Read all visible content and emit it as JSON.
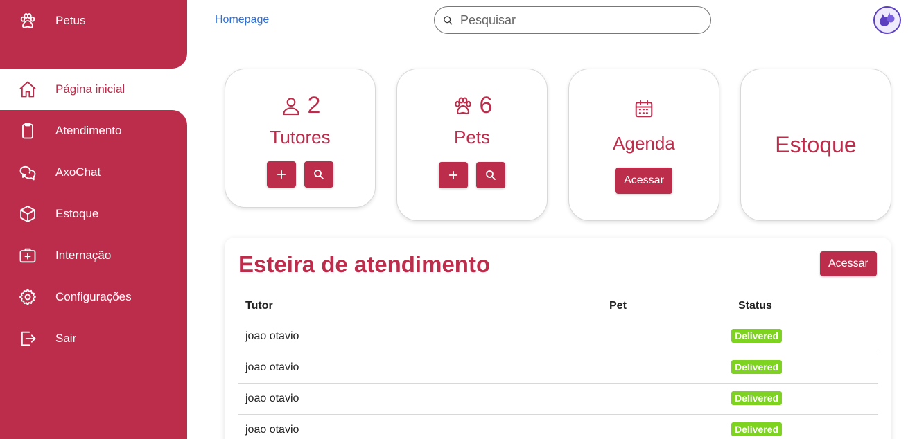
{
  "sidebar": {
    "brand": "Petus",
    "items": [
      {
        "label": "Página inicial",
        "icon": "home-icon"
      },
      {
        "label": "Atendimento",
        "icon": "clipboard-icon"
      },
      {
        "label": "AxoChat",
        "icon": "chat-icon"
      },
      {
        "label": "Estoque",
        "icon": "box-icon"
      },
      {
        "label": "Internação",
        "icon": "medical-kit-icon"
      },
      {
        "label": "Configurações",
        "icon": "gear-icon"
      },
      {
        "label": "Sair",
        "icon": "logout-icon"
      }
    ]
  },
  "header": {
    "breadcrumb": "Homepage",
    "search_placeholder": "Pesquisar"
  },
  "cards": {
    "tutores": {
      "count": "2",
      "title": "Tutores"
    },
    "pets": {
      "count": "6",
      "title": "Pets"
    },
    "agenda": {
      "title": "Agenda",
      "button": "Acessar"
    },
    "estoque": {
      "title": "Estoque"
    }
  },
  "queue": {
    "title": "Esteira de atendimento",
    "button": "Acessar",
    "columns": [
      "Tutor",
      "Pet",
      "Status"
    ],
    "rows": [
      {
        "tutor": "joao otavio",
        "pet": "",
        "status": "Delivered"
      },
      {
        "tutor": "joao otavio",
        "pet": "",
        "status": "Delivered"
      },
      {
        "tutor": "joao otavio",
        "pet": "",
        "status": "Delivered"
      },
      {
        "tutor": "joao otavio",
        "pet": "",
        "status": "Delivered"
      }
    ]
  },
  "colors": {
    "brand": "#bb2d4b",
    "link": "#2f6fd6",
    "status_delivered": "#7ed321"
  }
}
